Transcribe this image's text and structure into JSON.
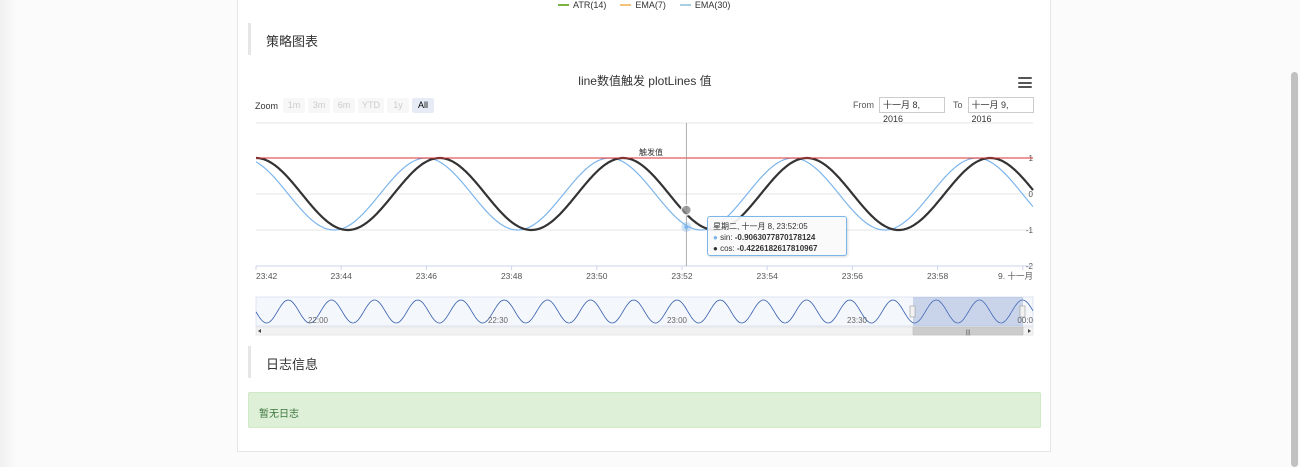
{
  "top_legend": [
    {
      "label": "ATR(14)",
      "color": "#7cb342"
    },
    {
      "label": "EMA(7)",
      "color": "#f4c27a"
    },
    {
      "label": "EMA(30)",
      "color": "#a8cfe0"
    }
  ],
  "sections": {
    "chart_heading": "策略图表",
    "log_heading": "日志信息",
    "log_empty": "暂无日志"
  },
  "chart": {
    "title": "line数值触发 plotLines 值",
    "zoom_label": "Zoom",
    "zoom_buttons": [
      "1m",
      "3m",
      "6m",
      "YTD",
      "1y",
      "All"
    ],
    "zoom_active": "All",
    "from_label": "From",
    "from_value": "十一月 8, 2016",
    "to_label": "To",
    "to_value": "十一月 9, 2016",
    "navigator_labels": [
      "22:00",
      "22:30",
      "23:00",
      "23:30",
      "00:0"
    ],
    "tooltip": {
      "header": "星期二, 十一月 8, 23:52:05",
      "rows": [
        {
          "name": "sin",
          "value": "-0.9063077870178124",
          "color": "#7cb5ec"
        },
        {
          "name": "cos",
          "value": "-0.4226182617810967",
          "color": "#333333"
        }
      ]
    }
  },
  "chart_data": {
    "type": "line",
    "title": "line数值触发 plotLines 值",
    "x_tick_labels": [
      "23:42",
      "23:44",
      "23:46",
      "23:48",
      "23:50",
      "23:52",
      "23:54",
      "23:56",
      "23:58",
      "9. 十一月"
    ],
    "y_tick_labels": [
      "1",
      "0",
      "-1",
      "-2"
    ],
    "ylim": [
      -2,
      1
    ],
    "xlim_minutes": [
      0,
      18.2
    ],
    "plot_line": {
      "value": 1,
      "label": "触发值",
      "color": "#e03030"
    },
    "series": [
      {
        "name": "sin",
        "color": "#7cb5ec",
        "function": "sin",
        "amplitude": 1,
        "period_minutes": 4.3,
        "phase_minutes": -0.32
      },
      {
        "name": "cos",
        "color": "#333333",
        "function": "cos",
        "amplitude": 1,
        "period_minutes": 4.3,
        "phase_minutes": 0
      }
    ],
    "crosshair_x_minutes": 10.08,
    "grid": true,
    "legend": "top"
  }
}
